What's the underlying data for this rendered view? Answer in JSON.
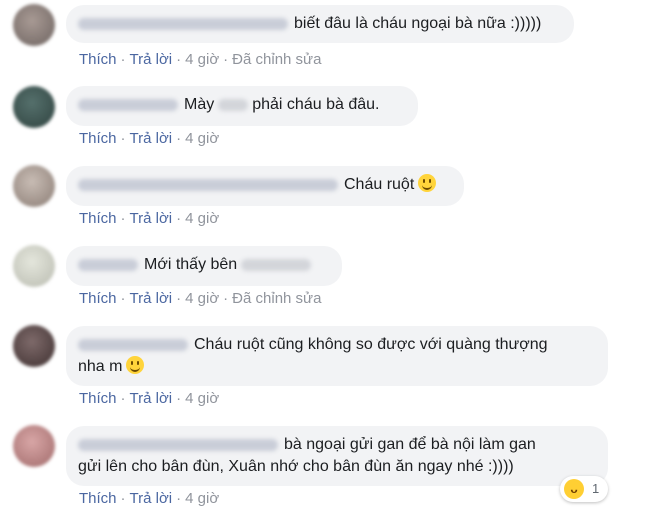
{
  "comments": [
    {
      "text": "biết đâu là cháu ngoại bà nữa :)))))",
      "actions": {
        "like": "Thích",
        "reply": "Trả lời",
        "time": "4 giờ",
        "edited": "Đã chỉnh sửa"
      }
    },
    {
      "text_before": "Mày",
      "text_after": "phải cháu bà đâu.",
      "actions": {
        "like": "Thích",
        "reply": "Trả lời",
        "time": "4 giờ"
      }
    },
    {
      "text": "Cháu ruột",
      "actions": {
        "like": "Thích",
        "reply": "Trả lời",
        "time": "4 giờ"
      }
    },
    {
      "text": "Mới thấy bên",
      "actions": {
        "like": "Thích",
        "reply": "Trả lời",
        "time": "4 giờ",
        "edited": "Đã chỉnh sửa"
      }
    },
    {
      "line1": "Cháu ruột cũng không so được với quàng thượng",
      "line2": "nha m",
      "actions": {
        "like": "Thích",
        "reply": "Trả lời",
        "time": "4 giờ"
      }
    },
    {
      "line1": "bà ngoại gửi gan để bà nội làm gan",
      "line2": "gửi lên cho bân đùn, Xuân nhớ cho bân đùn ăn ngay nhé :))))",
      "actions": {
        "like": "Thích",
        "reply": "Trả lời",
        "time": "4 giờ"
      },
      "reaction": {
        "icon": "haha-icon",
        "count": "1"
      }
    }
  ],
  "separator": "·",
  "colors": {
    "link": "#4b67a1",
    "meta": "#90949c",
    "bubble": "#f2f3f5"
  }
}
